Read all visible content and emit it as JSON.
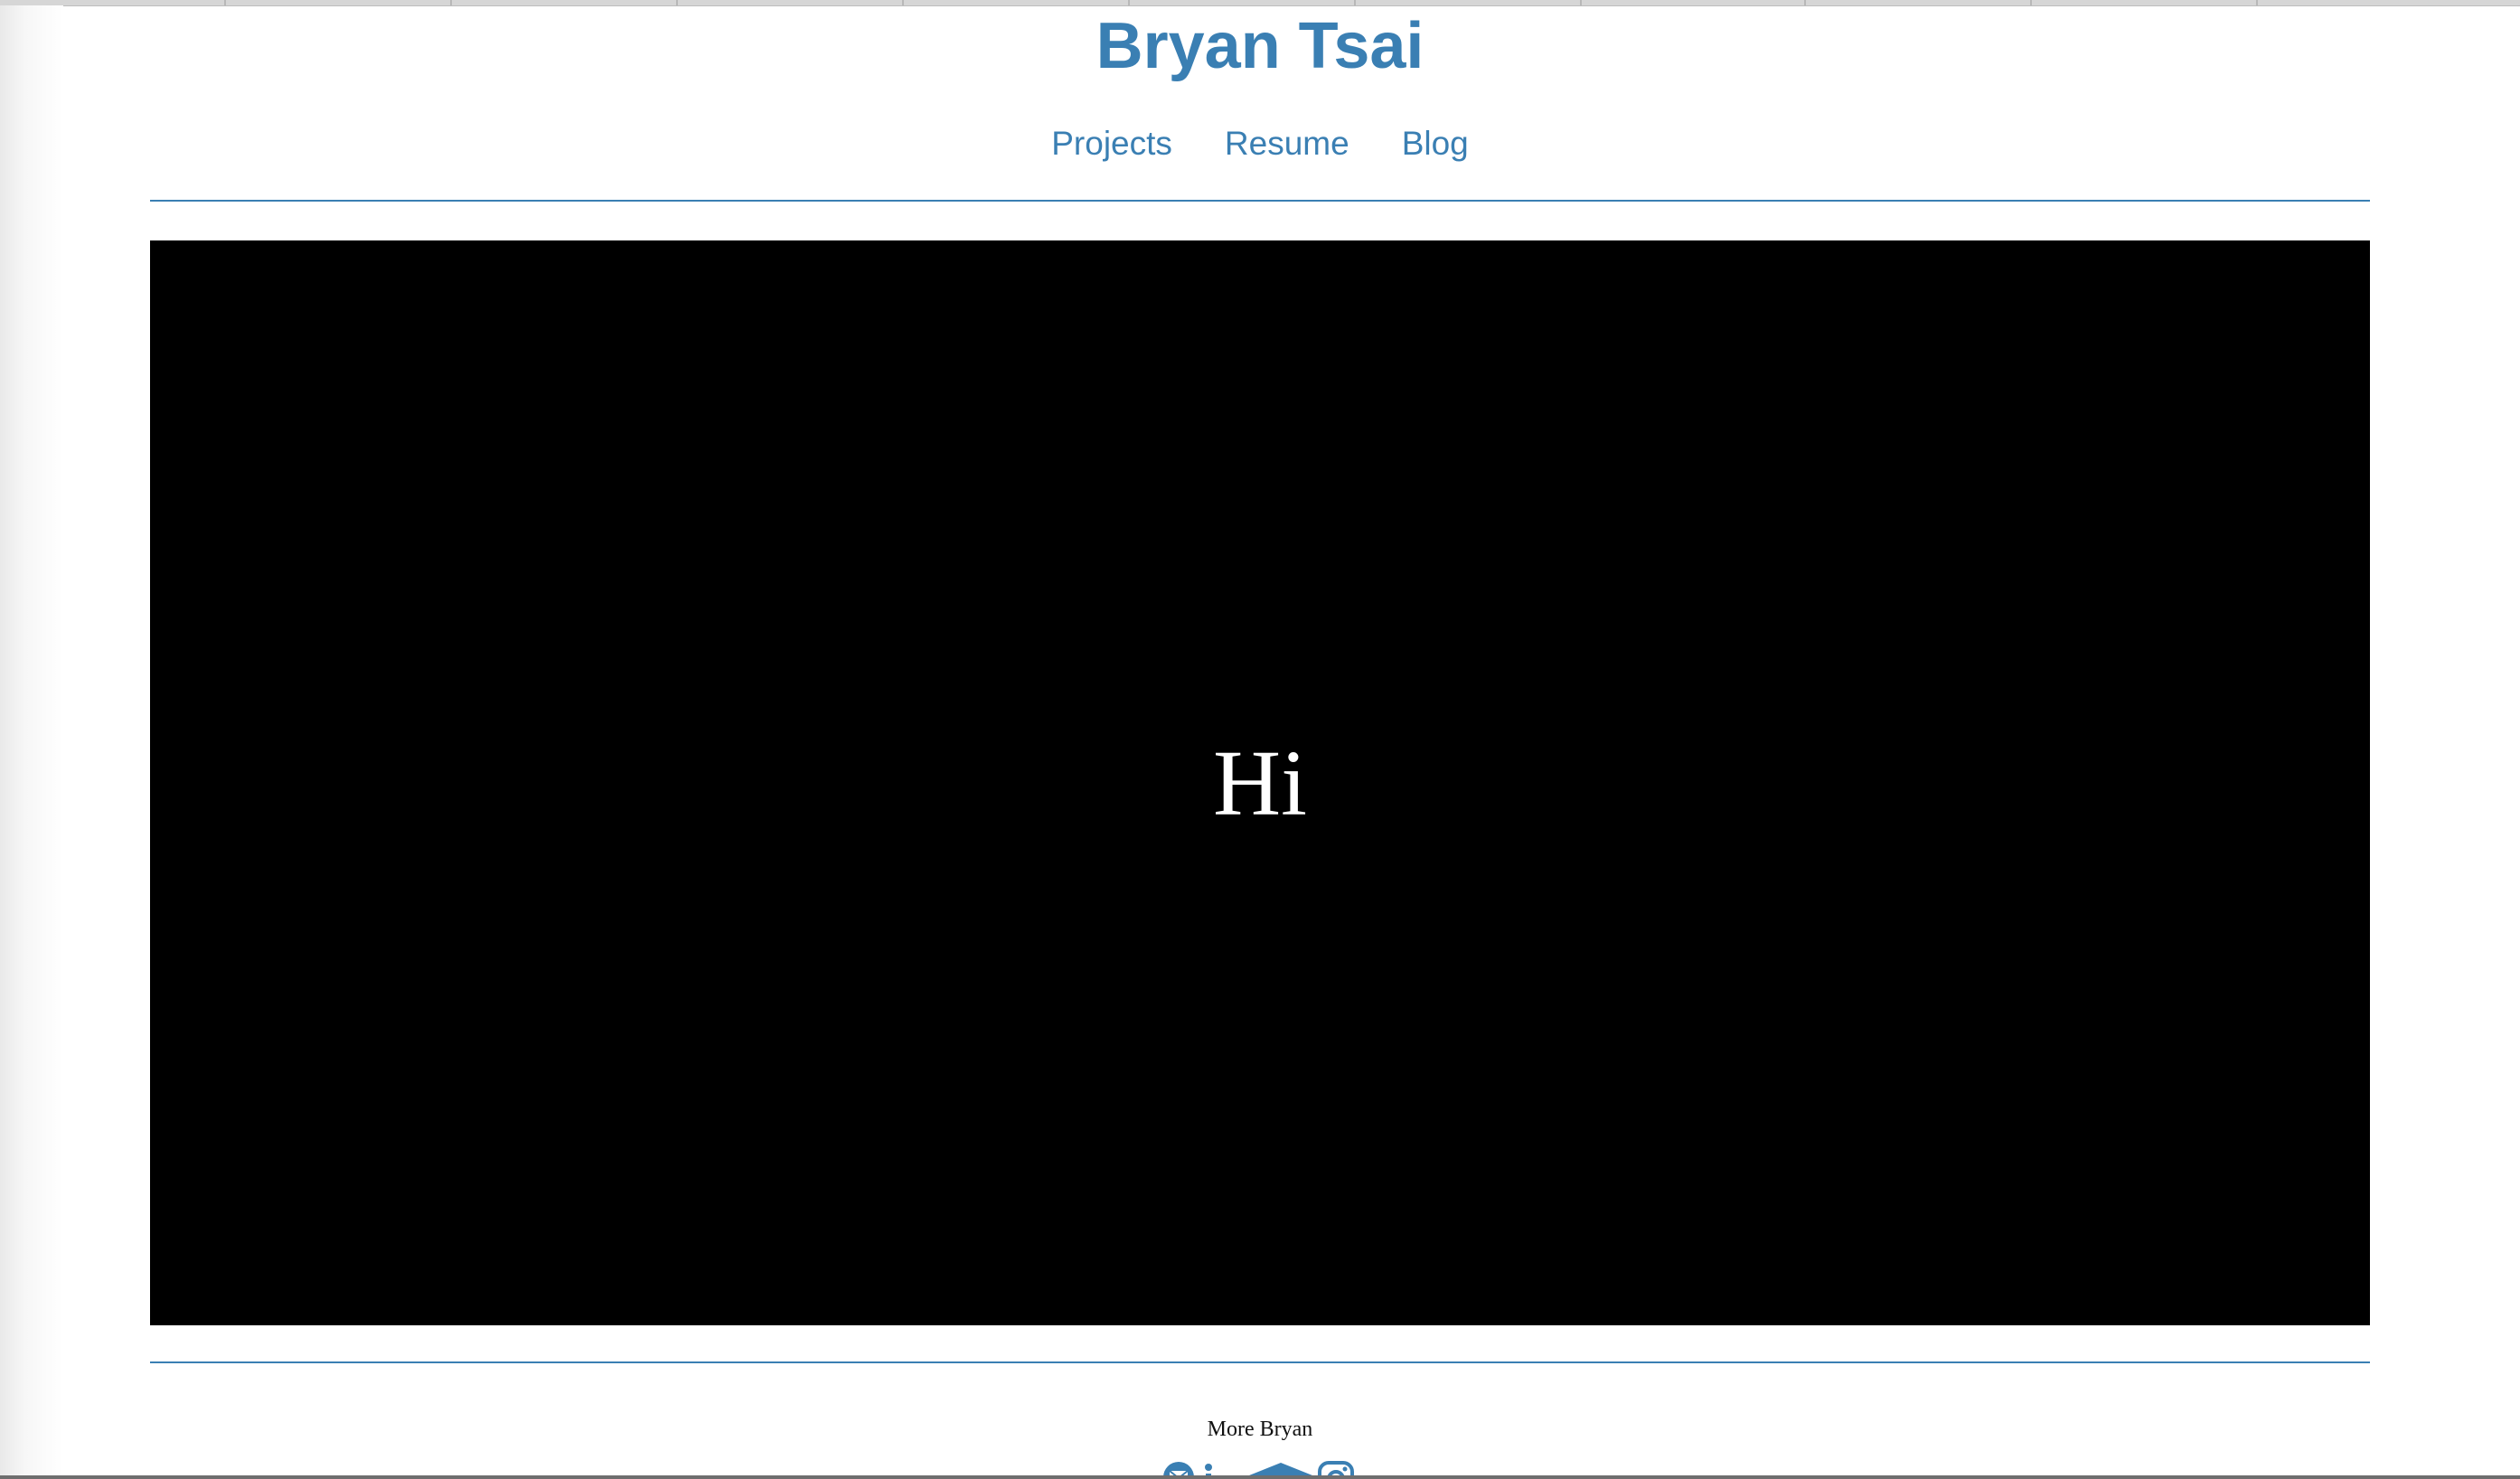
{
  "header": {
    "site_title": "Bryan Tsai"
  },
  "nav": {
    "items": [
      {
        "label": "Projects"
      },
      {
        "label": "Resume"
      },
      {
        "label": "Blog"
      }
    ]
  },
  "hero": {
    "text": "Hi"
  },
  "footer": {
    "heading": "More Bryan",
    "social_icons": [
      "email-icon",
      "linkedin-icon",
      "graduation-cap-icon",
      "instagram-icon"
    ]
  },
  "colors": {
    "accent": "#3a7fb3",
    "hero_background": "#000000",
    "hero_text": "#ffffff"
  }
}
